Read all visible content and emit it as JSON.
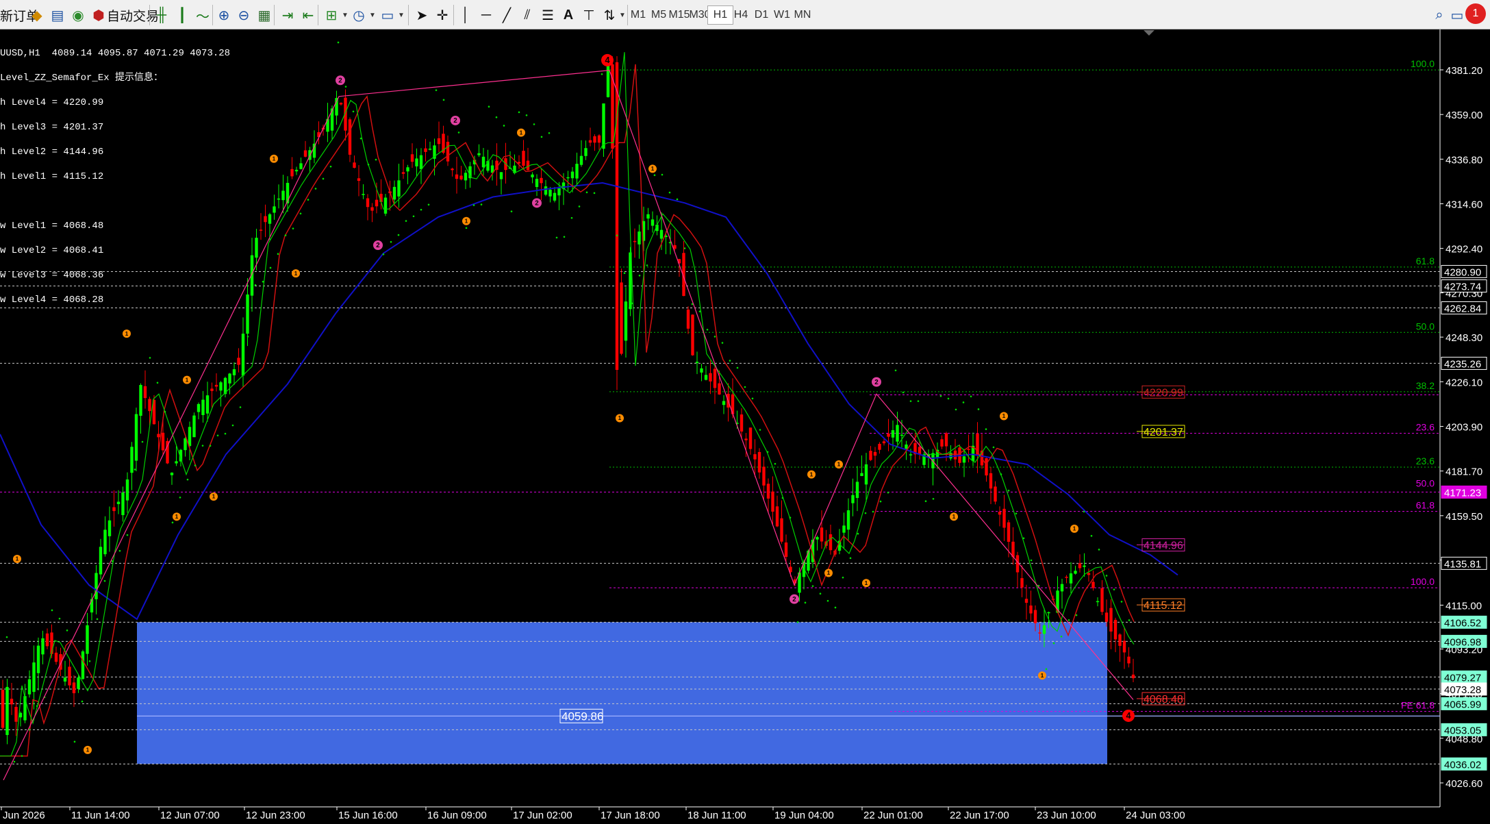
{
  "toolbar": {
    "new_order": "新订单",
    "auto_trade": "自动交易",
    "timeframes": [
      "M1",
      "M5",
      "M15",
      "M30",
      "H1",
      "H4",
      "D1",
      "W1",
      "MN"
    ],
    "active_timeframe": "H1",
    "notification_count": "1"
  },
  "info": {
    "header": "UUSD,H1  4089.14 4095.87 4071.29 4073.28",
    "indicator": "Level_ZZ_Semafor_Ex 提示信息：",
    "high_levels": [
      "h Level4 = 4220.99",
      "h Level3 = 4201.37",
      "h Level2 = 4144.96",
      "h Level1 = 4115.12"
    ],
    "low_levels": [
      "w Level1 = 4068.48",
      "w Level2 = 4068.41",
      "w Level3 = 4068.36",
      "w Level4 = 4068.28"
    ]
  },
  "colors": {
    "bull": "#00ff00",
    "bear": "#ff0000",
    "zone": "#4169e1",
    "grid": "#c0c0c0",
    "ma_blue": "#1010c8",
    "ma_red": "#d01010",
    "ma_green": "#00d000",
    "fib_green": "#00c000",
    "fib_magenta": "#e000e0"
  },
  "chart_data": {
    "type": "candlestick",
    "symbol": "UUSD",
    "timeframe": "H1",
    "ylim": [
      4018,
      4392
    ],
    "price_ticks": [
      4381.2,
      4359.0,
      4336.8,
      4314.6,
      4292.4,
      4270.3,
      4248.3,
      4226.1,
      4203.9,
      4181.7,
      4159.5,
      4137.4,
      4115.0,
      4093.2,
      4071.0,
      4048.8,
      4026.6
    ],
    "time_labels": [
      "Jun 2026",
      "11 Jun 14:00",
      "12 Jun 07:00",
      "12 Jun 23:00",
      "15 Jun 16:00",
      "16 Jun 09:00",
      "17 Jun 02:00",
      "17 Jun 18:00",
      "18 Jun 11:00",
      "19 Jun 04:00",
      "22 Jun 01:00",
      "22 Jun 17:00",
      "23 Jun 10:00",
      "24 Jun 03:00"
    ],
    "price_labels": [
      {
        "value": "4280.90",
        "price": 4280.9,
        "bg": "#000000",
        "fg": "#ffffff",
        "border": "#ffffff"
      },
      {
        "value": "4273.74",
        "price": 4273.74,
        "bg": "#000000",
        "fg": "#ffffff",
        "border": "#ffffff"
      },
      {
        "value": "4262.84",
        "price": 4262.84,
        "bg": "#000000",
        "fg": "#ffffff",
        "border": "#ffffff"
      },
      {
        "value": "4235.26",
        "price": 4235.26,
        "bg": "#000000",
        "fg": "#ffffff",
        "border": "#ffffff"
      },
      {
        "value": "4171.23",
        "price": 4171.23,
        "bg": "#e000e0",
        "fg": "#ffffff",
        "border": "#e000e0"
      },
      {
        "value": "4135.81",
        "price": 4135.81,
        "bg": "#000000",
        "fg": "#ffffff",
        "border": "#ffffff"
      },
      {
        "value": "4106.52",
        "price": 4106.52,
        "bg": "#7fffd4",
        "fg": "#000000",
        "border": "#7fffd4"
      },
      {
        "value": "4096.98",
        "price": 4096.98,
        "bg": "#7fffd4",
        "fg": "#000000",
        "border": "#7fffd4"
      },
      {
        "value": "4079.27",
        "price": 4079.27,
        "bg": "#7fffd4",
        "fg": "#000000",
        "border": "#7fffd4"
      },
      {
        "value": "4073.28",
        "price": 4073.28,
        "bg": "#ffffff",
        "fg": "#000000",
        "border": "#ffffff"
      },
      {
        "value": "4065.99",
        "price": 4065.99,
        "bg": "#7fffd4",
        "fg": "#000000",
        "border": "#7fffd4"
      },
      {
        "value": "4053.05",
        "price": 4053.05,
        "bg": "#7fffd4",
        "fg": "#000000",
        "border": "#7fffd4"
      },
      {
        "value": "4036.02",
        "price": 4036.02,
        "bg": "#7fffd4",
        "fg": "#000000",
        "border": "#7fffd4"
      }
    ],
    "level_boxes": [
      {
        "value": "4220.99",
        "price": 4220.99,
        "color": "#cc2222"
      },
      {
        "value": "4201.37",
        "price": 4201.37,
        "color": "#e8e800"
      },
      {
        "value": "4144.96",
        "price": 4144.96,
        "color": "#d020a0"
      },
      {
        "value": "4115.12",
        "price": 4115.12,
        "color": "#ff7f27"
      },
      {
        "value": "4068.48",
        "price": 4068.48,
        "color": "#ff3030"
      }
    ],
    "zone": {
      "high": 4106.52,
      "low": 4036.02,
      "label": "4059.86",
      "label_price": 4059.86
    },
    "fib_labels": [
      {
        "text": "100.0",
        "price": 4382.5,
        "color": "#00c000"
      },
      {
        "text": "61.8",
        "price": 4284.5,
        "color": "#00c000"
      },
      {
        "text": "50.0",
        "price": 4252.0,
        "color": "#00c000"
      },
      {
        "text": "38.2",
        "price": 4222.5,
        "color": "#00c000"
      },
      {
        "text": "23.6",
        "price": 4185.0,
        "color": "#00c000"
      },
      {
        "text": "23.6",
        "price": 4201.8,
        "color": "#e000e0"
      },
      {
        "text": "50.0",
        "price": 4174.0,
        "color": "#e000e0"
      },
      {
        "text": "61.8",
        "price": 4163.0,
        "color": "#e000e0"
      },
      {
        "text": "100.0",
        "price": 4125.0,
        "color": "#e000e0"
      },
      {
        "text": "FE 61.8",
        "price": 4063.5,
        "color": "#e000e0"
      }
    ]
  }
}
